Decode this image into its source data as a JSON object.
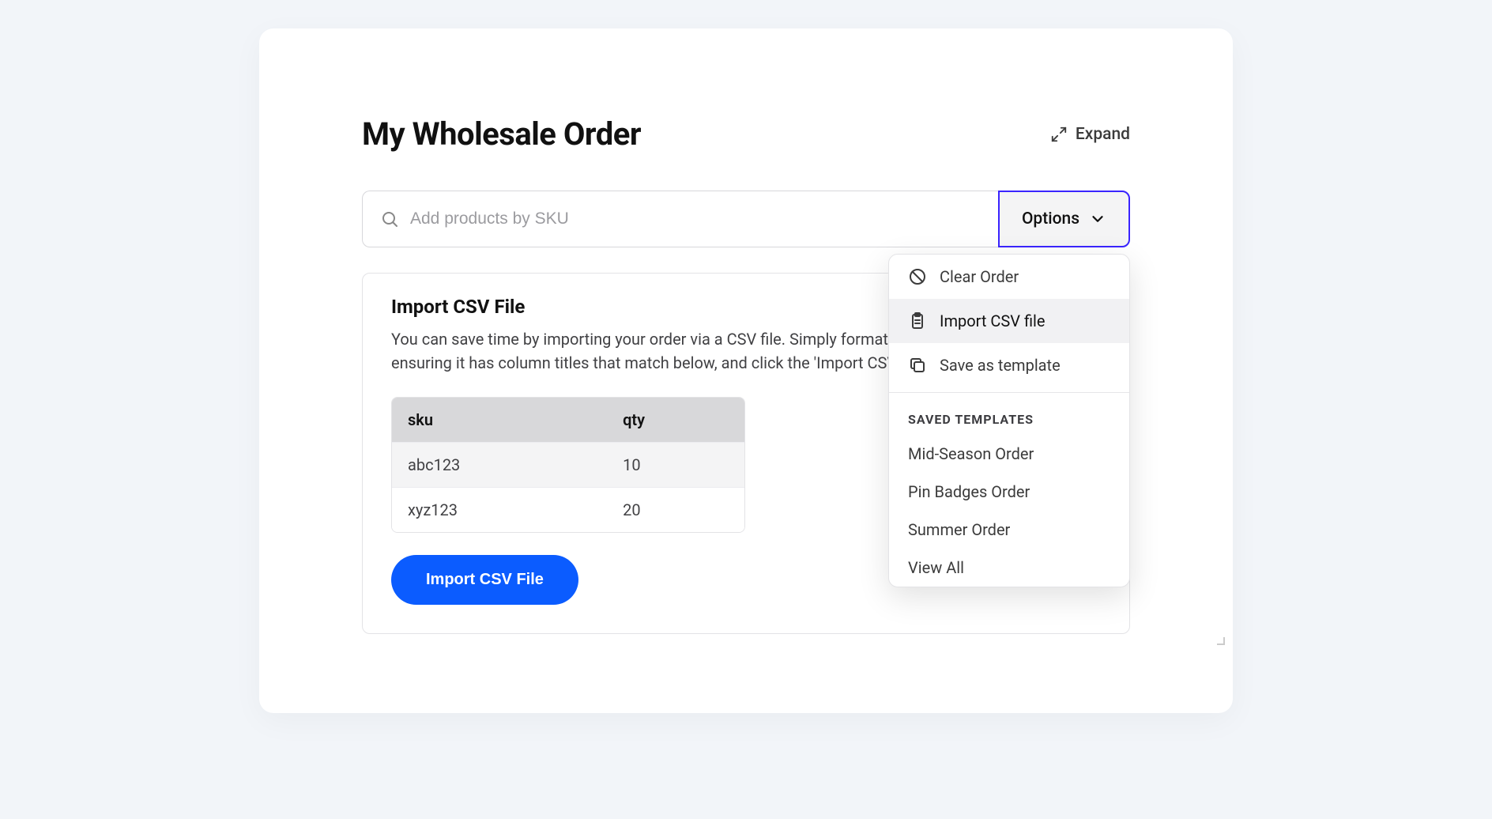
{
  "header": {
    "title": "My Wholesale Order",
    "expand_label": "Expand"
  },
  "search": {
    "placeholder": "Add products by SKU",
    "value": ""
  },
  "options_button": {
    "label": "Options"
  },
  "options_menu": {
    "items": [
      {
        "icon": "ban-icon",
        "label": "Clear Order"
      },
      {
        "icon": "clipboard-icon",
        "label": "Import CSV file"
      },
      {
        "icon": "copy-icon",
        "label": "Save as template"
      }
    ],
    "highlighted_index": 1,
    "templates_heading": "SAVED TEMPLATES",
    "templates": [
      "Mid-Season Order",
      "Pin Badges Order",
      "Summer Order",
      "View All"
    ]
  },
  "import_panel": {
    "title": "Import CSV File",
    "description": "You can save time by importing your order via a CSV file. Simply format the CSV, ensuring it has column titles that match below, and click the 'Import CSV' button",
    "example_table": {
      "headers": [
        "sku",
        "qty"
      ],
      "rows": [
        [
          "abc123",
          "10"
        ],
        [
          "xyz123",
          "20"
        ]
      ]
    },
    "button_label": "Import CSV File"
  }
}
